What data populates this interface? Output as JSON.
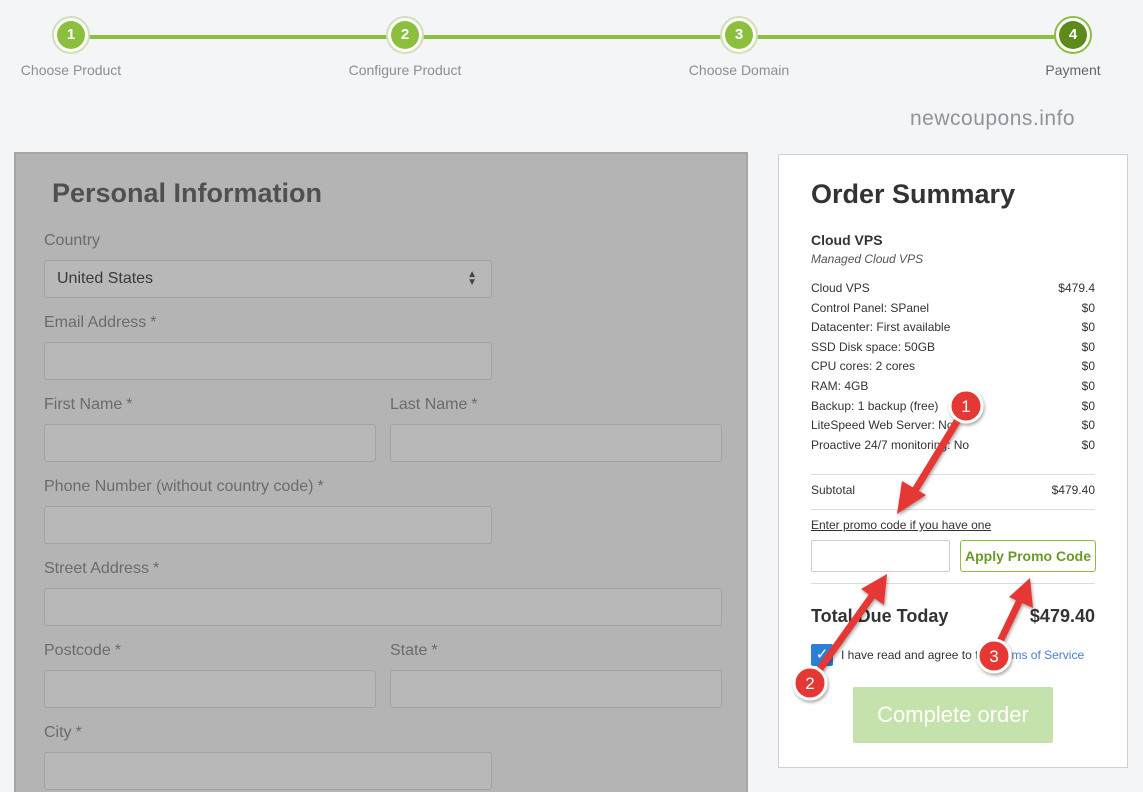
{
  "steps": [
    {
      "number": "1",
      "label": "Choose Product"
    },
    {
      "number": "2",
      "label": "Configure Product"
    },
    {
      "number": "3",
      "label": "Choose Domain"
    },
    {
      "number": "4",
      "label": "Payment"
    }
  ],
  "watermark": "newcoupons.info",
  "personal_info": {
    "title": "Personal Information",
    "country_label": "Country",
    "country_value": "United States",
    "email_label": "Email Address",
    "first_name_label": "First Name",
    "last_name_label": "Last Name",
    "phone_label": "Phone Number (without country code)",
    "street_label": "Street Address",
    "postcode_label": "Postcode",
    "state_label": "State",
    "city_label": "City",
    "required_mark": "*"
  },
  "order_summary": {
    "title": "Order Summary",
    "product_name": "Cloud VPS",
    "product_subtitle": "Managed Cloud VPS",
    "lines": [
      {
        "label": "Cloud VPS",
        "price": "$479.4"
      },
      {
        "label": "Control Panel: SPanel",
        "price": "$0"
      },
      {
        "label": "Datacenter: First available",
        "price": "$0"
      },
      {
        "label": "SSD Disk space: 50GB",
        "price": "$0"
      },
      {
        "label": "CPU cores: 2 cores",
        "price": "$0"
      },
      {
        "label": "RAM: 4GB",
        "price": "$0"
      },
      {
        "label": "Backup: 1 backup (free)",
        "price": "$0"
      },
      {
        "label": "LiteSpeed Web Server: No",
        "price": "$0"
      },
      {
        "label": "Proactive 24/7 monitoring: No",
        "price": "$0"
      }
    ],
    "subtotal_label": "Subtotal",
    "subtotal_value": "$479.40",
    "promo_link": "Enter promo code if you have one",
    "promo_button": "Apply Promo Code",
    "total_label": "Total Due Today",
    "total_value": "$479.40",
    "agree_text": "I have read and agree to the",
    "agree_link": "Terms of Service",
    "complete_button": "Complete order"
  },
  "annotations": [
    {
      "number": "1"
    },
    {
      "number": "2"
    },
    {
      "number": "3"
    }
  ],
  "colors": {
    "accent_green": "#8dbf3f",
    "annotation_red": "#e53935",
    "checkbox_blue": "#2c7fd6"
  }
}
